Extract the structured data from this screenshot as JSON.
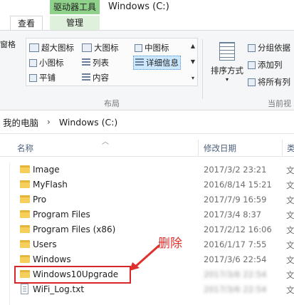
{
  "titlebar": {
    "context_tab_head": "驱动器工具",
    "window_title": "Windows (C:)"
  },
  "tabs": {
    "view": "查看",
    "manage": "管理"
  },
  "ribbon": {
    "left_fragment": "窗格",
    "layout": {
      "items": [
        "超大图标",
        "大图标",
        "中图标",
        "小图标",
        "列表",
        "详细信息",
        "平铺",
        "内容"
      ],
      "selected": "详细信息",
      "group_label": "布局"
    },
    "sort": {
      "label": "排序方式",
      "group_label": "当前视"
    },
    "side_options": [
      "分组依据",
      "添加列",
      "将所有列"
    ]
  },
  "address": {
    "crumbs": [
      "我的电脑",
      "Windows (C:)"
    ]
  },
  "columns": {
    "name": "名称",
    "date": "修改日期",
    "type": "类"
  },
  "files": [
    {
      "name": "Image",
      "date": "2017/3/2 23:21",
      "type": "文",
      "icon": "folder-icon"
    },
    {
      "name": "MyFlash",
      "date": "2016/8/14 15:21",
      "type": "文",
      "icon": "folder-icon"
    },
    {
      "name": "Pro",
      "date": "2017/7/9 16:59",
      "type": "文",
      "icon": "folder-icon"
    },
    {
      "name": "Program Files",
      "date": "2017/3/4 8:37",
      "type": "文",
      "icon": "folder-icon"
    },
    {
      "name": "Program Files (x86)",
      "date": "2017/2/12 16:06",
      "type": "文",
      "icon": "folder-icon"
    },
    {
      "name": "Users",
      "date": "2016/1/17 7:55",
      "type": "文",
      "icon": "folder-icon"
    },
    {
      "name": "Windows",
      "date": "2017/3/6 22:54",
      "type": "文",
      "icon": "folder-icon"
    },
    {
      "name": "Windows10Upgrade",
      "date": "2017/3/6 22:54",
      "type": "文",
      "icon": "folder-icon"
    },
    {
      "name": "WiFi_Log.txt",
      "date": "2017/3/6 22:54",
      "type": "文",
      "icon": "file-icon"
    }
  ],
  "annotation": {
    "text": "删除",
    "color": "#e0302d"
  }
}
